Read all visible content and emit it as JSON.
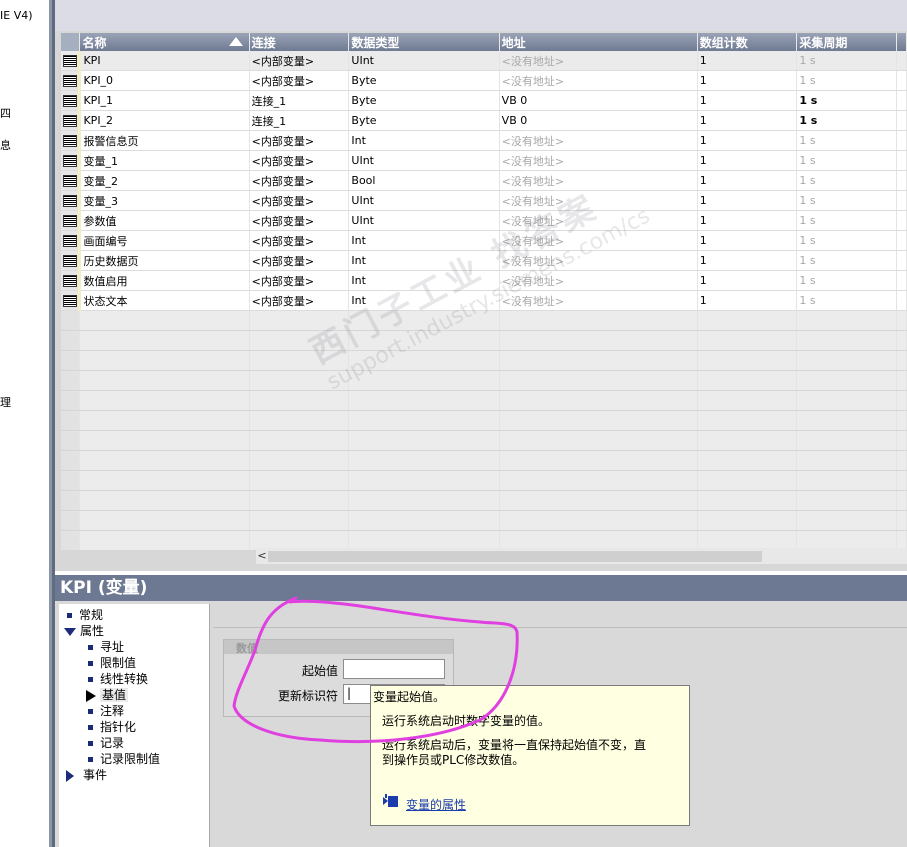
{
  "left_tree": {
    "fragments": [
      "IE V4)",
      "四",
      "息",
      "理"
    ]
  },
  "grid": {
    "columns": [
      "名称",
      "连接",
      "数据类型",
      "地址",
      "数组计数",
      "采集周期"
    ],
    "rows": [
      {
        "name": "KPI",
        "connection": "<内部变量>",
        "type": "UInt",
        "address": "<没有地址>",
        "count": "1",
        "cycle": "1 s",
        "cycle_gray": true,
        "address_gray": true
      },
      {
        "name": "KPI_0",
        "connection": "<内部变量>",
        "type": "Byte",
        "address": "<没有地址>",
        "count": "1",
        "cycle": "1 s",
        "cycle_gray": true,
        "address_gray": true
      },
      {
        "name": "KPI_1",
        "connection": "连接_1",
        "type": "Byte",
        "address": "VB 0",
        "count": "1",
        "cycle": "1 s",
        "cycle_gray": false,
        "address_gray": false
      },
      {
        "name": "KPI_2",
        "connection": "连接_1",
        "type": "Byte",
        "address": "VB 0",
        "count": "1",
        "cycle": "1 s",
        "cycle_gray": false,
        "address_gray": false
      },
      {
        "name": "报警信息页",
        "connection": "<内部变量>",
        "type": "Int",
        "address": "<没有地址>",
        "count": "1",
        "cycle": "1 s",
        "cycle_gray": true,
        "address_gray": true
      },
      {
        "name": "变量_1",
        "connection": "<内部变量>",
        "type": "UInt",
        "address": "<没有地址>",
        "count": "1",
        "cycle": "1 s",
        "cycle_gray": true,
        "address_gray": true
      },
      {
        "name": "变量_2",
        "connection": "<内部变量>",
        "type": "Bool",
        "address": "<没有地址>",
        "count": "1",
        "cycle": "1 s",
        "cycle_gray": true,
        "address_gray": true
      },
      {
        "name": "变量_3",
        "connection": "<内部变量>",
        "type": "UInt",
        "address": "<没有地址>",
        "count": "1",
        "cycle": "1 s",
        "cycle_gray": true,
        "address_gray": true
      },
      {
        "name": "参数值",
        "connection": "<内部变量>",
        "type": "UInt",
        "address": "<没有地址>",
        "count": "1",
        "cycle": "1 s",
        "cycle_gray": true,
        "address_gray": true
      },
      {
        "name": "画面编号",
        "connection": "<内部变量>",
        "type": "Int",
        "address": "<没有地址>",
        "count": "1",
        "cycle": "1 s",
        "cycle_gray": true,
        "address_gray": true
      },
      {
        "name": "历史数据页",
        "connection": "<内部变量>",
        "type": "Int",
        "address": "<没有地址>",
        "count": "1",
        "cycle": "1 s",
        "cycle_gray": true,
        "address_gray": true
      },
      {
        "name": "数值启用",
        "connection": "<内部变量>",
        "type": "Int",
        "address": "<没有地址>",
        "count": "1",
        "cycle": "1 s",
        "cycle_gray": true,
        "address_gray": true
      },
      {
        "name": "状态文本",
        "connection": "<内部变量>",
        "type": "Int",
        "address": "<没有地址>",
        "count": "1",
        "cycle": "1 s",
        "cycle_gray": true,
        "address_gray": true
      }
    ],
    "scroll_left_glyph": "<"
  },
  "watermark": {
    "line1": "西门子工业  找答案",
    "line2": "support.industry.siemens.com/cs"
  },
  "inspector": {
    "title": "KPI (变量)",
    "nav": {
      "general": "常规",
      "properties": "属性",
      "addressing": "寻址",
      "limits": "限制值",
      "linear_scaling": "线性转换",
      "base_value": "基值",
      "comment": "注释",
      "pointer": "指针化",
      "logging": "记录",
      "logging_limits": "记录限制值",
      "events": "事件"
    },
    "group": {
      "title": "数值",
      "start_value_label": "起始值",
      "start_value": "",
      "update_id_label": "更新标识符",
      "update_id_value": "|"
    }
  },
  "tooltip": {
    "title": "变量起始值。",
    "line1": "运行系统启动时数字变量的值。",
    "line2": "运行系统启动后，变量将一直保持起始值不变，直",
    "line3": "到操作员或PLC修改数值。",
    "link": "变量的属性"
  },
  "colors": {
    "header_bg": "#6d7893",
    "annotation": "#e040e0",
    "tooltip_bg": "#ffffe1",
    "link": "#1a3cad"
  }
}
